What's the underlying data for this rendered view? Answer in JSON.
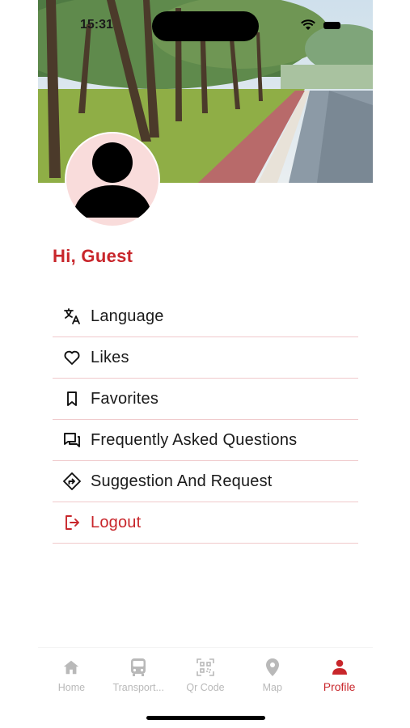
{
  "status_bar": {
    "time": "15:31"
  },
  "profile": {
    "greeting": "Hi, Guest"
  },
  "menu": {
    "items": [
      {
        "label": "Language",
        "icon": "translate-icon"
      },
      {
        "label": "Likes",
        "icon": "heart-icon"
      },
      {
        "label": "Favorites",
        "icon": "bookmark-icon"
      },
      {
        "label": "Frequently Asked Questions",
        "icon": "chat-bubbles-icon"
      },
      {
        "label": "Suggestion And Request",
        "icon": "directions-diamond-icon"
      },
      {
        "label": "Logout",
        "icon": "logout-icon"
      }
    ]
  },
  "tabbar": {
    "active": "Profile",
    "tabs": [
      {
        "label": "Home",
        "icon": "home-icon"
      },
      {
        "label": "Transport...",
        "icon": "bus-icon"
      },
      {
        "label": "Qr Code",
        "icon": "qr-code-icon"
      },
      {
        "label": "Map",
        "icon": "map-pin-icon"
      },
      {
        "label": "Profile",
        "icon": "person-icon"
      }
    ]
  },
  "colors": {
    "accent": "#c8262b",
    "divider": "#f0c9cb",
    "inactive": "#b9b9b9",
    "avatar_bg": "#f9dcdb"
  }
}
